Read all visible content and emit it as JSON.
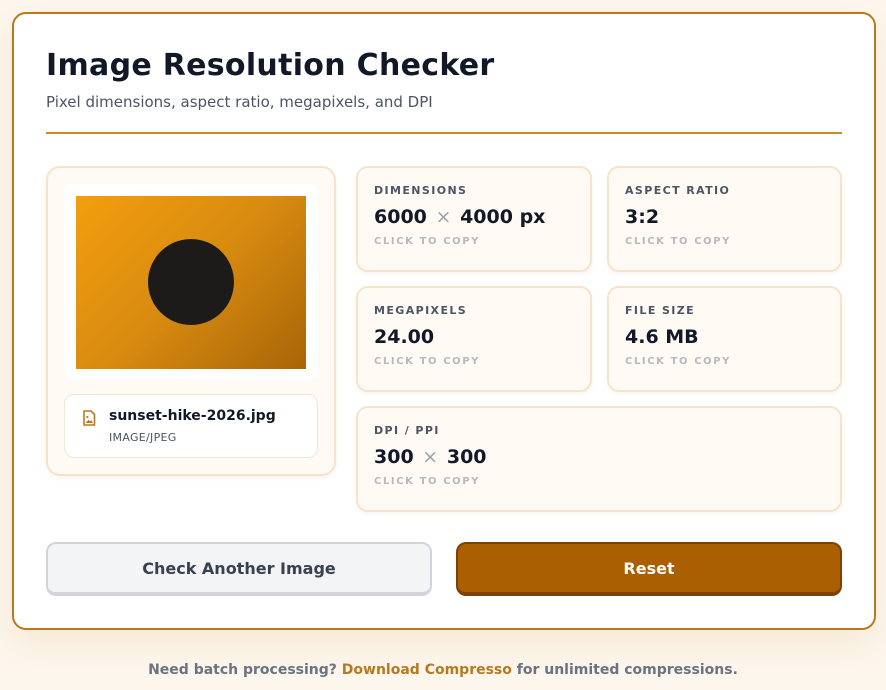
{
  "header": {
    "title": "Image Resolution Checker",
    "subtitle": "Pixel dimensions, aspect ratio, megapixels, and DPI"
  },
  "file": {
    "name": "sunset-hike-2026.jpg",
    "type": "IMAGE/JPEG",
    "icon": "image-file-icon"
  },
  "stats": {
    "dimensions": {
      "label": "DIMENSIONS",
      "width": "6000",
      "height": "4000",
      "unit": "px",
      "hint": "CLICK TO COPY"
    },
    "aspect_ratio": {
      "label": "ASPECT RATIO",
      "value": "3:2",
      "hint": "CLICK TO COPY"
    },
    "megapixels": {
      "label": "MEGAPIXELS",
      "value": "24.00",
      "hint": "CLICK TO COPY"
    },
    "file_size": {
      "label": "FILE SIZE",
      "value": "4.6 MB",
      "hint": "CLICK TO COPY"
    },
    "dpi": {
      "label": "DPI / PPI",
      "x": "300",
      "y": "300",
      "hint": "CLICK TO COPY"
    },
    "separator": "×"
  },
  "actions": {
    "check_another": "Check Another Image",
    "reset": "Reset"
  },
  "footer": {
    "prefix": "Need batch processing?",
    "link": "Download Compresso",
    "suffix": "for unlimited compressions."
  },
  "colors": {
    "accent": "#b7791f",
    "primary_button": "#aa5f02",
    "card_border": "#f6e3cc"
  }
}
